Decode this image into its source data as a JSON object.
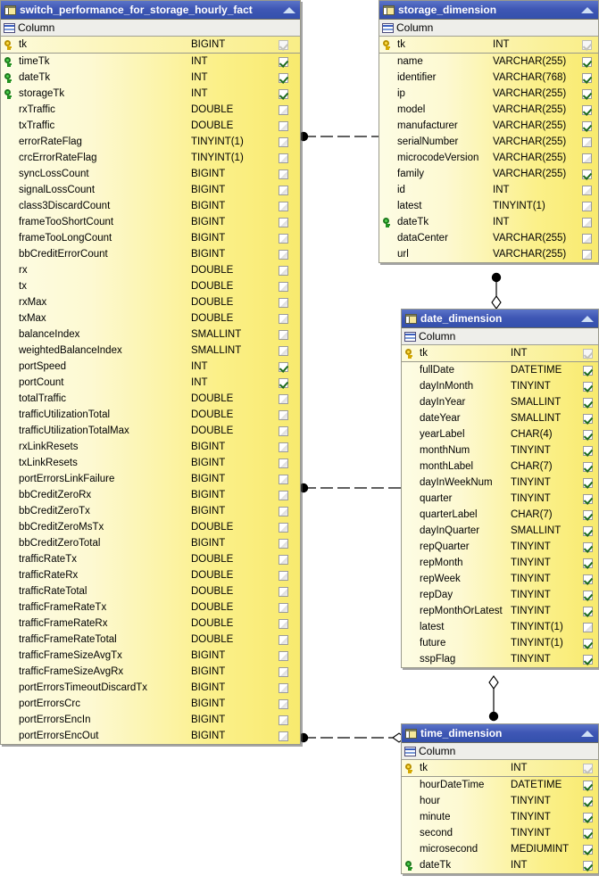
{
  "diagram": {
    "kind": "entity-relationship-diagram",
    "colors": {
      "title_bar": "#3f57b5",
      "title_text": "#ffffff",
      "row_body_light": "#fdfce4",
      "row_body_dark": "#f8ea6e",
      "border": "#9a9a8c",
      "pk_key": "#ffdd44",
      "fk_key": "#4cd04c",
      "check": "#1d6b1d"
    },
    "column_header_label": "Column",
    "collapse_icon": "collapse-triangle-icon",
    "table_icon": "table-icon",
    "grid_icon": "grid-icon"
  },
  "entities": [
    {
      "id": "fact",
      "title": "switch_performance_for_storage_hourly_fact",
      "columns": [
        {
          "name": "tk",
          "type": "BIGINT",
          "key": "pk",
          "checked": "disabled"
        },
        {
          "name": "timeTk",
          "type": "INT",
          "key": "fk",
          "checked": "checked"
        },
        {
          "name": "dateTk",
          "type": "INT",
          "key": "fk",
          "checked": "checked"
        },
        {
          "name": "storageTk",
          "type": "INT",
          "key": "fk",
          "checked": "checked"
        },
        {
          "name": "rxTraffic",
          "type": "DOUBLE",
          "key": "",
          "checked": "unchecked"
        },
        {
          "name": "txTraffic",
          "type": "DOUBLE",
          "key": "",
          "checked": "unchecked"
        },
        {
          "name": "errorRateFlag",
          "type": "TINYINT(1)",
          "key": "",
          "checked": "unchecked"
        },
        {
          "name": "crcErrorRateFlag",
          "type": "TINYINT(1)",
          "key": "",
          "checked": "unchecked"
        },
        {
          "name": "syncLossCount",
          "type": "BIGINT",
          "key": "",
          "checked": "unchecked"
        },
        {
          "name": "signalLossCount",
          "type": "BIGINT",
          "key": "",
          "checked": "unchecked"
        },
        {
          "name": "class3DiscardCount",
          "type": "BIGINT",
          "key": "",
          "checked": "unchecked"
        },
        {
          "name": "frameTooShortCount",
          "type": "BIGINT",
          "key": "",
          "checked": "unchecked"
        },
        {
          "name": "frameTooLongCount",
          "type": "BIGINT",
          "key": "",
          "checked": "unchecked"
        },
        {
          "name": "bbCreditErrorCount",
          "type": "BIGINT",
          "key": "",
          "checked": "unchecked"
        },
        {
          "name": "rx",
          "type": "DOUBLE",
          "key": "",
          "checked": "unchecked"
        },
        {
          "name": "tx",
          "type": "DOUBLE",
          "key": "",
          "checked": "unchecked"
        },
        {
          "name": "rxMax",
          "type": "DOUBLE",
          "key": "",
          "checked": "unchecked"
        },
        {
          "name": "txMax",
          "type": "DOUBLE",
          "key": "",
          "checked": "unchecked"
        },
        {
          "name": "balanceIndex",
          "type": "SMALLINT",
          "key": "",
          "checked": "unchecked"
        },
        {
          "name": "weightedBalanceIndex",
          "type": "SMALLINT",
          "key": "",
          "checked": "unchecked"
        },
        {
          "name": "portSpeed",
          "type": "INT",
          "key": "",
          "checked": "checked"
        },
        {
          "name": "portCount",
          "type": "INT",
          "key": "",
          "checked": "checked"
        },
        {
          "name": "totalTraffic",
          "type": "DOUBLE",
          "key": "",
          "checked": "unchecked"
        },
        {
          "name": "trafficUtilizationTotal",
          "type": "DOUBLE",
          "key": "",
          "checked": "unchecked"
        },
        {
          "name": "trafficUtilizationTotalMax",
          "type": "DOUBLE",
          "key": "",
          "checked": "unchecked"
        },
        {
          "name": "rxLinkResets",
          "type": "BIGINT",
          "key": "",
          "checked": "unchecked"
        },
        {
          "name": "txLinkResets",
          "type": "BIGINT",
          "key": "",
          "checked": "unchecked"
        },
        {
          "name": "portErrorsLinkFailure",
          "type": "BIGINT",
          "key": "",
          "checked": "unchecked"
        },
        {
          "name": "bbCreditZeroRx",
          "type": "BIGINT",
          "key": "",
          "checked": "unchecked"
        },
        {
          "name": "bbCreditZeroTx",
          "type": "BIGINT",
          "key": "",
          "checked": "unchecked"
        },
        {
          "name": "bbCreditZeroMsTx",
          "type": "DOUBLE",
          "key": "",
          "checked": "unchecked"
        },
        {
          "name": "bbCreditZeroTotal",
          "type": "BIGINT",
          "key": "",
          "checked": "unchecked"
        },
        {
          "name": "trafficRateTx",
          "type": "DOUBLE",
          "key": "",
          "checked": "unchecked"
        },
        {
          "name": "trafficRateRx",
          "type": "DOUBLE",
          "key": "",
          "checked": "unchecked"
        },
        {
          "name": "trafficRateTotal",
          "type": "DOUBLE",
          "key": "",
          "checked": "unchecked"
        },
        {
          "name": "trafficFrameRateTx",
          "type": "DOUBLE",
          "key": "",
          "checked": "unchecked"
        },
        {
          "name": "trafficFrameRateRx",
          "type": "DOUBLE",
          "key": "",
          "checked": "unchecked"
        },
        {
          "name": "trafficFrameRateTotal",
          "type": "DOUBLE",
          "key": "",
          "checked": "unchecked"
        },
        {
          "name": "trafficFrameSizeAvgTx",
          "type": "BIGINT",
          "key": "",
          "checked": "unchecked"
        },
        {
          "name": "trafficFrameSizeAvgRx",
          "type": "BIGINT",
          "key": "",
          "checked": "unchecked"
        },
        {
          "name": "portErrorsTimeoutDiscardTx",
          "type": "BIGINT",
          "key": "",
          "checked": "unchecked"
        },
        {
          "name": "portErrorsCrc",
          "type": "BIGINT",
          "key": "",
          "checked": "unchecked"
        },
        {
          "name": "portErrorsEncIn",
          "type": "BIGINT",
          "key": "",
          "checked": "unchecked"
        },
        {
          "name": "portErrorsEncOut",
          "type": "BIGINT",
          "key": "",
          "checked": "unchecked"
        }
      ]
    },
    {
      "id": "storage",
      "title": "storage_dimension",
      "columns": [
        {
          "name": "tk",
          "type": "INT",
          "key": "pk",
          "checked": "disabled"
        },
        {
          "name": "name",
          "type": "VARCHAR(255)",
          "key": "",
          "checked": "checked"
        },
        {
          "name": "identifier",
          "type": "VARCHAR(768)",
          "key": "",
          "checked": "checked"
        },
        {
          "name": "ip",
          "type": "VARCHAR(255)",
          "key": "",
          "checked": "checked"
        },
        {
          "name": "model",
          "type": "VARCHAR(255)",
          "key": "",
          "checked": "checked"
        },
        {
          "name": "manufacturer",
          "type": "VARCHAR(255)",
          "key": "",
          "checked": "checked"
        },
        {
          "name": "serialNumber",
          "type": "VARCHAR(255)",
          "key": "",
          "checked": "unchecked"
        },
        {
          "name": "microcodeVersion",
          "type": "VARCHAR(255)",
          "key": "",
          "checked": "unchecked"
        },
        {
          "name": "family",
          "type": "VARCHAR(255)",
          "key": "",
          "checked": "checked"
        },
        {
          "name": "id",
          "type": "INT",
          "key": "",
          "checked": "unchecked"
        },
        {
          "name": "latest",
          "type": "TINYINT(1)",
          "key": "",
          "checked": "unchecked"
        },
        {
          "name": "dateTk",
          "type": "INT",
          "key": "fk",
          "checked": "unchecked"
        },
        {
          "name": "dataCenter",
          "type": "VARCHAR(255)",
          "key": "",
          "checked": "unchecked"
        },
        {
          "name": "url",
          "type": "VARCHAR(255)",
          "key": "",
          "checked": "unchecked"
        }
      ]
    },
    {
      "id": "date",
      "title": "date_dimension",
      "columns": [
        {
          "name": "tk",
          "type": "INT",
          "key": "pk",
          "checked": "disabled"
        },
        {
          "name": "fullDate",
          "type": "DATETIME",
          "key": "",
          "checked": "checked"
        },
        {
          "name": "dayInMonth",
          "type": "TINYINT",
          "key": "",
          "checked": "checked"
        },
        {
          "name": "dayInYear",
          "type": "SMALLINT",
          "key": "",
          "checked": "checked"
        },
        {
          "name": "dateYear",
          "type": "SMALLINT",
          "key": "",
          "checked": "checked"
        },
        {
          "name": "yearLabel",
          "type": "CHAR(4)",
          "key": "",
          "checked": "checked"
        },
        {
          "name": "monthNum",
          "type": "TINYINT",
          "key": "",
          "checked": "checked"
        },
        {
          "name": "monthLabel",
          "type": "CHAR(7)",
          "key": "",
          "checked": "checked"
        },
        {
          "name": "dayInWeekNum",
          "type": "TINYINT",
          "key": "",
          "checked": "checked"
        },
        {
          "name": "quarter",
          "type": "TINYINT",
          "key": "",
          "checked": "checked"
        },
        {
          "name": "quarterLabel",
          "type": "CHAR(7)",
          "key": "",
          "checked": "checked"
        },
        {
          "name": "dayInQuarter",
          "type": "SMALLINT",
          "key": "",
          "checked": "checked"
        },
        {
          "name": "repQuarter",
          "type": "TINYINT",
          "key": "",
          "checked": "checked"
        },
        {
          "name": "repMonth",
          "type": "TINYINT",
          "key": "",
          "checked": "checked"
        },
        {
          "name": "repWeek",
          "type": "TINYINT",
          "key": "",
          "checked": "checked"
        },
        {
          "name": "repDay",
          "type": "TINYINT",
          "key": "",
          "checked": "checked"
        },
        {
          "name": "repMonthOrLatest",
          "type": "TINYINT",
          "key": "",
          "checked": "checked"
        },
        {
          "name": "latest",
          "type": "TINYINT(1)",
          "key": "",
          "checked": "unchecked"
        },
        {
          "name": "future",
          "type": "TINYINT(1)",
          "key": "",
          "checked": "checked"
        },
        {
          "name": "sspFlag",
          "type": "TINYINT",
          "key": "",
          "checked": "checked"
        }
      ]
    },
    {
      "id": "time",
      "title": "time_dimension",
      "columns": [
        {
          "name": "tk",
          "type": "INT",
          "key": "pk",
          "checked": "disabled"
        },
        {
          "name": "hourDateTime",
          "type": "DATETIME",
          "key": "",
          "checked": "checked"
        },
        {
          "name": "hour",
          "type": "TINYINT",
          "key": "",
          "checked": "checked"
        },
        {
          "name": "minute",
          "type": "TINYINT",
          "key": "",
          "checked": "checked"
        },
        {
          "name": "second",
          "type": "TINYINT",
          "key": "",
          "checked": "checked"
        },
        {
          "name": "microsecond",
          "type": "MEDIUMINT",
          "key": "",
          "checked": "checked"
        },
        {
          "name": "dateTk",
          "type": "INT",
          "key": "fk",
          "checked": "checked"
        }
      ]
    }
  ],
  "relationships": [
    {
      "id": "fact-storage",
      "from": "fact",
      "to": "storage",
      "from_marker": "filled-circle",
      "to_marker": "open-diamond",
      "style": "dashed",
      "orientation": "horizontal"
    },
    {
      "id": "storage-date",
      "from": "storage",
      "to": "date",
      "from_marker": "filled-circle",
      "to_marker": "open-diamond",
      "style": "solid",
      "orientation": "vertical"
    },
    {
      "id": "fact-date",
      "from": "fact",
      "to": "date",
      "from_marker": "filled-circle",
      "to_marker": "open-diamond",
      "style": "dashed",
      "orientation": "horizontal"
    },
    {
      "id": "time-date",
      "from": "time",
      "to": "date",
      "from_marker": "filled-circle",
      "to_marker": "open-diamond",
      "style": "solid",
      "orientation": "vertical"
    },
    {
      "id": "fact-time",
      "from": "fact",
      "to": "time",
      "from_marker": "filled-circle",
      "to_marker": "open-diamond",
      "style": "dashed",
      "orientation": "horizontal"
    }
  ]
}
